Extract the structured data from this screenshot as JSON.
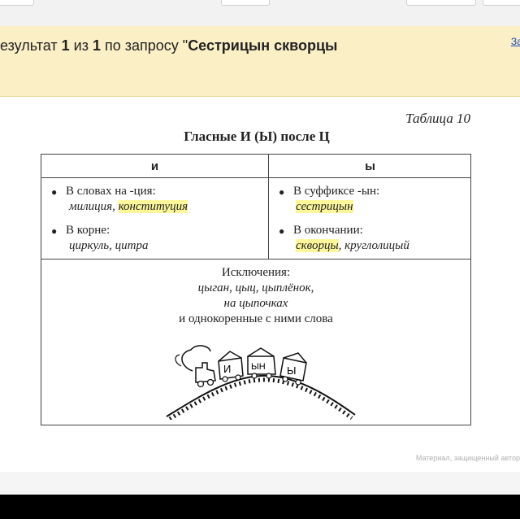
{
  "results": {
    "prefix": "езультат ",
    "current": "1",
    "of": " из ",
    "total": "1",
    "query_lead": " по запросу \"",
    "query": "Сестрицын скворцы",
    "close_label": "Зак"
  },
  "table": {
    "number": "Таблица 10",
    "title": "Гласные  И (Ы) после  Ц",
    "col_i": "и",
    "col_y": "ы",
    "left": {
      "rule1": "В словах на -ция:",
      "ex1_plain": "милиция, ",
      "ex1_hl": "конституция",
      "rule2": "В корне:",
      "ex2": "циркуль, цитра"
    },
    "right": {
      "rule1": "В суффиксе -ын:",
      "ex1_hl": "сестрицын",
      "rule2": "В окончании:",
      "ex2_hl": "скворцы",
      "ex2_plain": ", круглолицый"
    },
    "exceptions": {
      "heading": "Исключения:",
      "line1": "цыган, цыц, цыплёнок,",
      "line2": "на цыпочках",
      "line3": "и однокоренные с ними слова"
    },
    "illustration": {
      "car1": "И",
      "car2": "ЫН",
      "car3": "Ы"
    }
  },
  "watermark": "Материал, защищенный автор"
}
